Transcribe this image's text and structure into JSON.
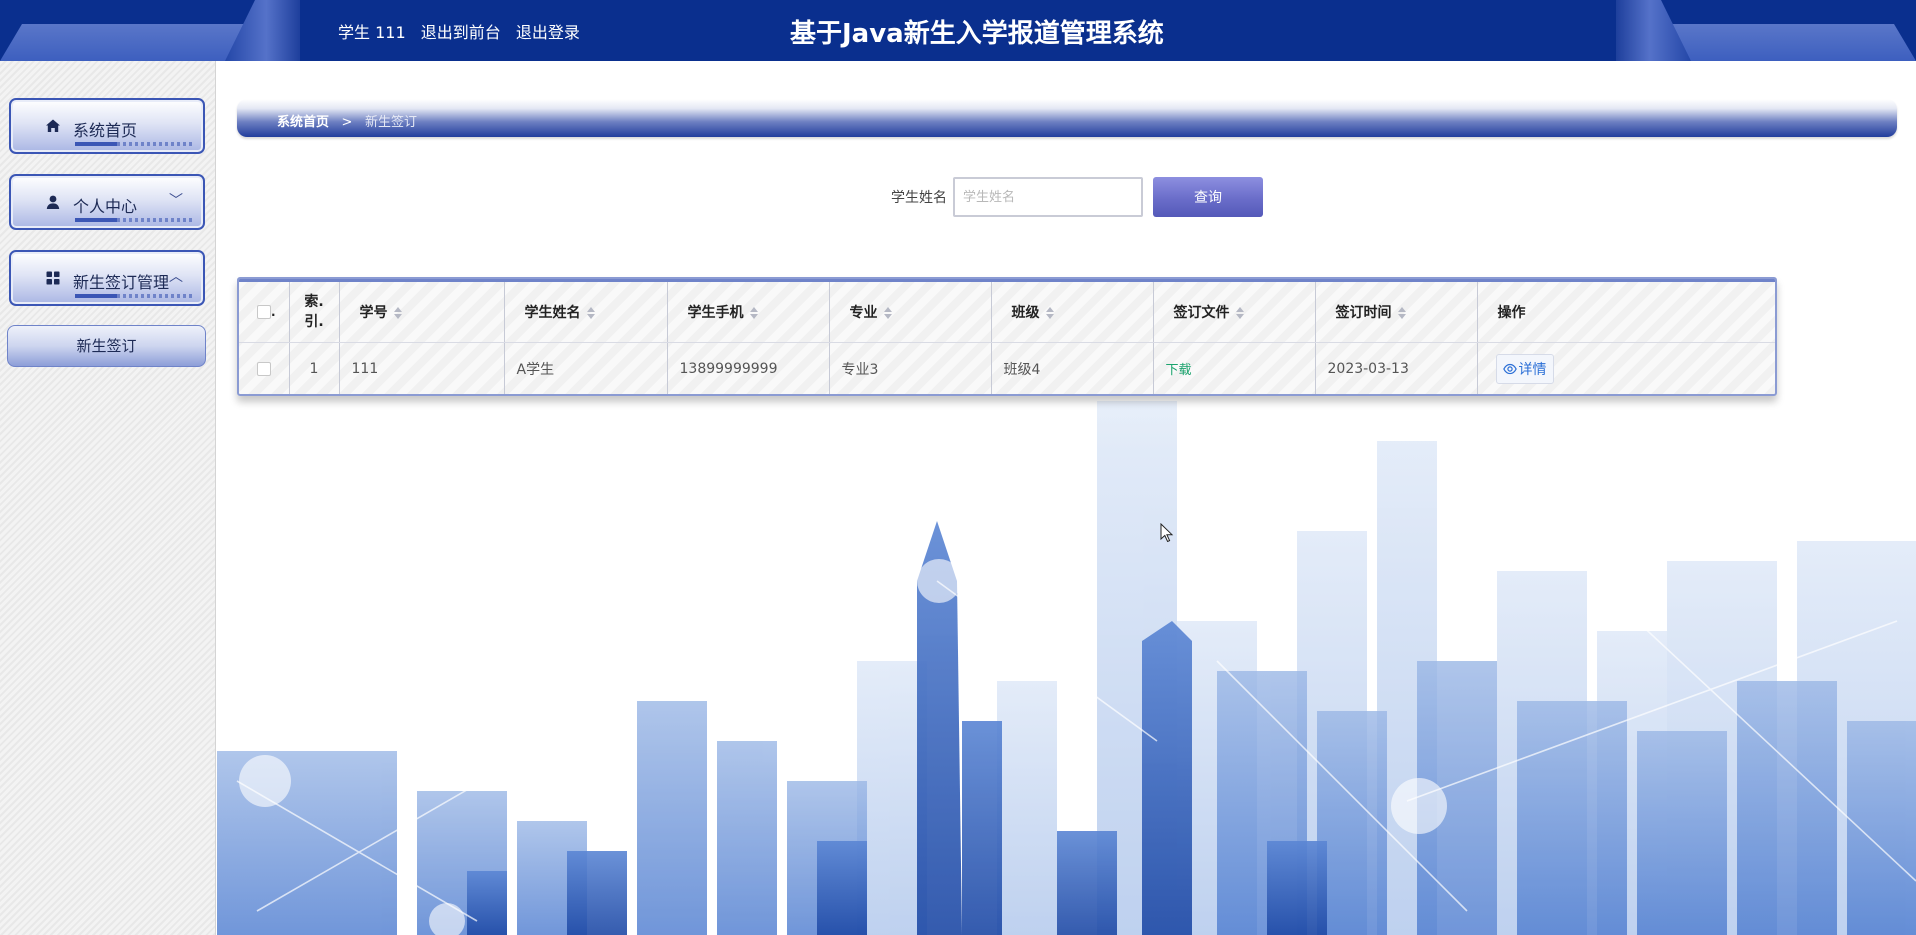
{
  "header": {
    "user_label": "学生 111",
    "front_link": "退出到前台",
    "logout_link": "退出登录",
    "title": "基于Java新生入学报道管理系统"
  },
  "sidebar": {
    "items": [
      {
        "label": "系统首页",
        "icon": "home-icon"
      },
      {
        "label": "个人中心",
        "icon": "user-icon",
        "chevron": "﹀"
      },
      {
        "label": "新生签订管理",
        "icon": "grid-icon",
        "chevron": "︿"
      }
    ],
    "sub_items": [
      {
        "label": "新生签订"
      }
    ]
  },
  "breadcrumb": {
    "home": "系统首页",
    "separator": ">",
    "current": "新生签订"
  },
  "search": {
    "label": "学生姓名",
    "placeholder": "学生姓名",
    "value": "",
    "button_label": "查询"
  },
  "table": {
    "columns": [
      {
        "label": "",
        "key": "check"
      },
      {
        "label": "索引",
        "key": "index"
      },
      {
        "label": "学号",
        "key": "student_no",
        "sortable": true
      },
      {
        "label": "学生姓名",
        "key": "name",
        "sortable": true
      },
      {
        "label": "学生手机",
        "key": "phone",
        "sortable": true
      },
      {
        "label": "专业",
        "key": "major",
        "sortable": true
      },
      {
        "label": "班级",
        "key": "class",
        "sortable": true
      },
      {
        "label": "签订文件",
        "key": "file",
        "sortable": true
      },
      {
        "label": "签订时间",
        "key": "time",
        "sortable": true
      },
      {
        "label": "操作",
        "key": "op"
      }
    ],
    "index_head_line1": "索.",
    "index_head_line2": "引.",
    "rows": [
      {
        "index": "1",
        "student_no": "111",
        "name": "A学生",
        "phone": "13899999999",
        "major": "专业3",
        "class": "班级4",
        "file": "下载",
        "time": "2023-03-13",
        "op": "详情"
      }
    ]
  },
  "colors": {
    "header_bg": "#0a2f8e",
    "accent": "#3b56b5",
    "button": "#6a6dc9",
    "download_link": "#1aa36d",
    "detail_link": "#2b6fd6"
  }
}
